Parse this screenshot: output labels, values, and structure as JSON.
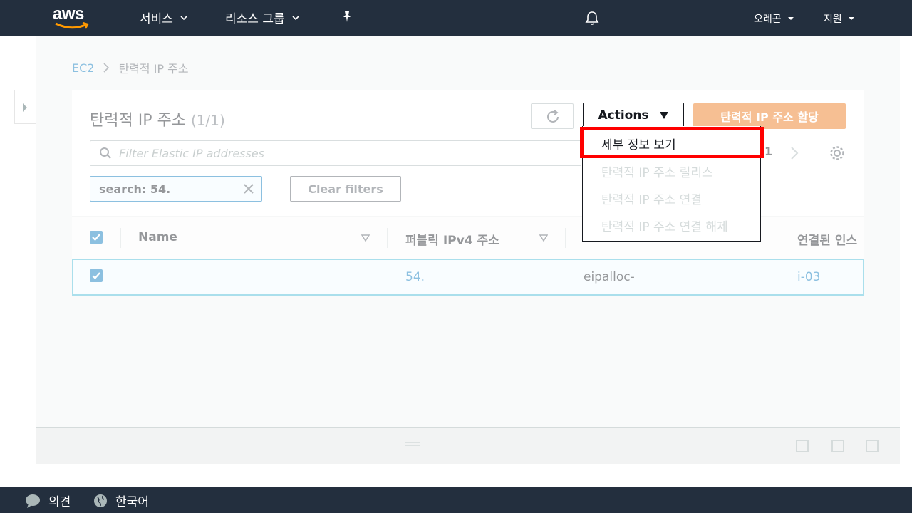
{
  "nav": {
    "logo": "aws",
    "services": "서비스",
    "resource_groups": "리소스 그룹",
    "region": "오레곤",
    "support": "지원"
  },
  "breadcrumb": {
    "root": "EC2",
    "current": "탄력적 IP 주소"
  },
  "panel": {
    "title": "탄력적 IP 주소",
    "count": "(1/1)",
    "actions_label": "Actions",
    "allocate_label": "탄력적 IP 주소 할당",
    "filter_placeholder": "Filter Elastic IP addresses",
    "page_number": "1",
    "token": "search: 54.",
    "clear_filters": "Clear filters"
  },
  "table": {
    "headers": [
      "Name",
      "퍼블릭 IPv4 주소",
      "연결된 인스"
    ],
    "rows": [
      {
        "name": "",
        "public_ip": "54.",
        "allocation_id": "eipalloc-",
        "instance": "i-03"
      }
    ]
  },
  "actions_menu": {
    "items": [
      {
        "label": "세부 정보 보기",
        "enabled": true
      },
      {
        "label": "탄력적 IP 주소 릴리스",
        "enabled": false
      },
      {
        "label": "탄력적 IP 주소 연결",
        "enabled": false
      },
      {
        "label": "탄력적 IP 주소 연결 해제",
        "enabled": false
      }
    ]
  },
  "footer": {
    "feedback": "의견",
    "language": "한국어"
  },
  "colors": {
    "nav_bg": "#232f3e",
    "primary_orange": "#ec7211",
    "link_blue": "#0073bb",
    "highlight_red": "#ff0000"
  }
}
